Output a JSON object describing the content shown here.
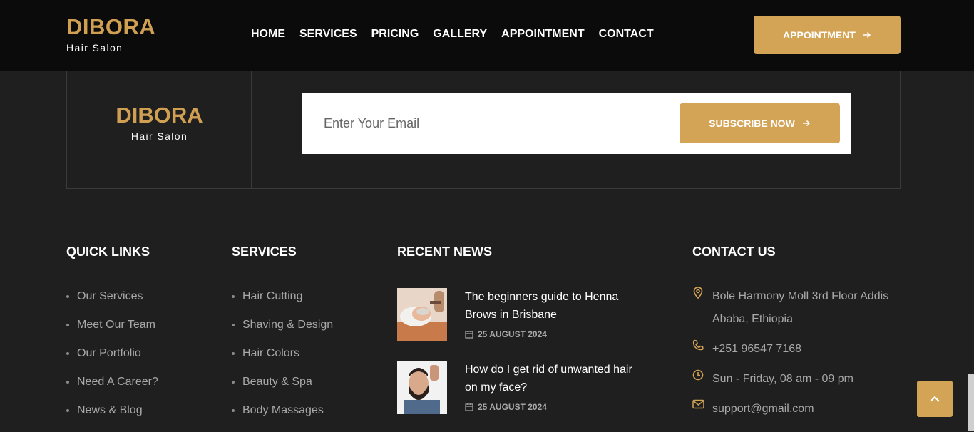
{
  "header": {
    "logo_title": "DIBORA",
    "logo_subtitle": "Hair Salon",
    "nav": [
      "HOME",
      "SERVICES",
      "PRICING",
      "GALLERY",
      "APPOINTMENT",
      "CONTACT"
    ],
    "cta_label": "APPOINTMENT"
  },
  "newsletter": {
    "logo_title": "DIBORA",
    "logo_subtitle": "Hair Salon",
    "email_placeholder": "Enter Your Email",
    "subscribe_label": "SUBSCRIBE NOW"
  },
  "quick_links": {
    "heading": "QUICK LINKS",
    "items": [
      "Our Services",
      "Meet Our Team",
      "Our Portfolio",
      "Need A Career?",
      "News & Blog"
    ]
  },
  "services": {
    "heading": "SERVICES",
    "items": [
      "Hair Cutting",
      "Shaving & Design",
      "Hair Colors",
      "Beauty & Spa",
      "Body Massages"
    ]
  },
  "recent_news": {
    "heading": "RECENT NEWS",
    "items": [
      {
        "title": "The beginners guide to Henna Brows in Brisbane",
        "date": "25 AUGUST 2024"
      },
      {
        "title": "How do I get rid of unwanted hair on my face?",
        "date": "25 AUGUST 2024"
      }
    ]
  },
  "contact": {
    "heading": "CONTACT US",
    "address": "Bole Harmony Moll 3rd Floor Addis Ababa, Ethiopia",
    "phone": "+251 96547 7168",
    "hours": "Sun - Friday, 08 am - 09 pm",
    "email": "support@gmail.com"
  },
  "colors": {
    "accent": "#d4a456",
    "header_bg": "#0b0b0b",
    "footer_bg": "#1f1f1f"
  }
}
